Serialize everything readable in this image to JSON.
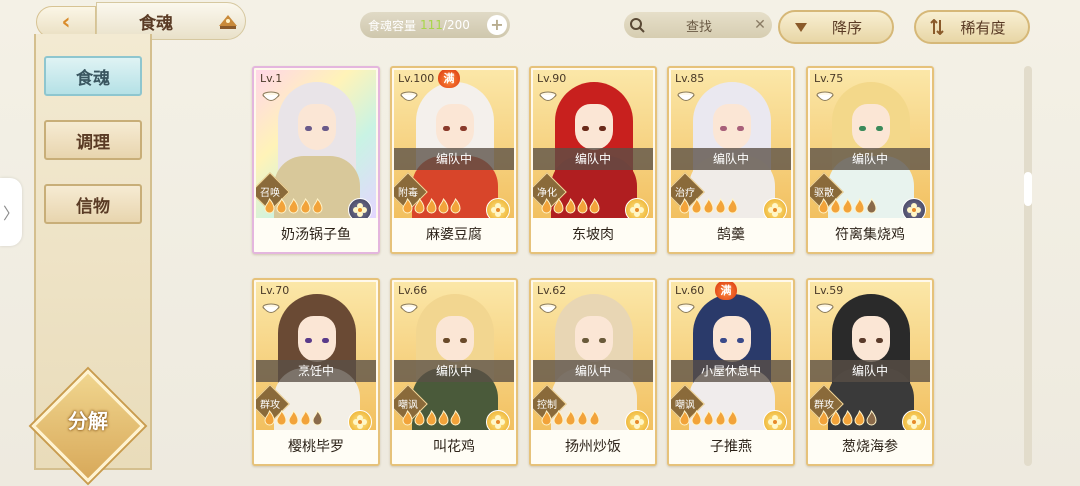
{
  "header": {
    "title": "食魂",
    "capacity_label": "食魂容量",
    "capacity_current": "111",
    "capacity_max": "/200",
    "capacity_add": "+",
    "search_label": "查找",
    "search_clear": "✕",
    "sort_order": "降序",
    "sort_rarity": "稀有度"
  },
  "sidebar": {
    "items": [
      {
        "label": "食魂",
        "active": true
      },
      {
        "label": "调理",
        "active": false
      },
      {
        "label": "信物",
        "active": false
      }
    ],
    "decompose": "分解",
    "edge_handle": "〉"
  },
  "cards": [
    {
      "level": "Lv.1",
      "name": "奶汤锅子鱼",
      "status": "",
      "role": "召唤",
      "full": false,
      "rarity": "sr",
      "element": "dark",
      "hair": "#e9e4e8",
      "clothes": "#d8c89a",
      "eyes": "#6a5a8a",
      "flames_lit": 5
    },
    {
      "level": "Lv.100",
      "name": "麻婆豆腐",
      "status": "编队中",
      "role": "附毒",
      "full": true,
      "full_label": "满",
      "rarity": "normal",
      "element": "gold",
      "hair": "#f4f0ec",
      "clothes": "#d8452a",
      "eyes": "#8a3a2a",
      "flames_lit": 5
    },
    {
      "level": "Lv.90",
      "name": "东坡肉",
      "status": "编队中",
      "role": "净化",
      "full": false,
      "rarity": "normal",
      "element": "gold",
      "hair": "#c8201e",
      "clothes": "#b01e20",
      "eyes": "#6a2a1a",
      "flames_lit": 5
    },
    {
      "level": "Lv.85",
      "name": "鹄羹",
      "status": "编队中",
      "role": "治疗",
      "full": false,
      "rarity": "normal",
      "element": "gold",
      "hair": "#eae8f0",
      "clothes": "#f0ece8",
      "eyes": "#a8607a",
      "flames_lit": 5
    },
    {
      "level": "Lv.75",
      "name": "符离集烧鸡",
      "status": "编队中",
      "role": "驱散",
      "full": false,
      "rarity": "normal",
      "element": "dark",
      "hair": "#f3d88a",
      "clothes": "#e8f3ee",
      "eyes": "#3a8a5a",
      "flames_lit": 4
    },
    {
      "level": "Lv.70",
      "name": "樱桃毕罗",
      "status": "烹饪中",
      "role": "群攻",
      "full": false,
      "rarity": "normal",
      "element": "gold",
      "hair": "#6a4a34",
      "clothes": "#f3efe6",
      "eyes": "#5a3a8a",
      "flames_lit": 4
    },
    {
      "level": "Lv.66",
      "name": "叫花鸡",
      "status": "编队中",
      "role": "嘲讽",
      "full": false,
      "rarity": "normal",
      "element": "gold",
      "hair": "#f2d690",
      "clothes": "#4a5a3a",
      "eyes": "#6a4a2a",
      "flames_lit": 5
    },
    {
      "level": "Lv.62",
      "name": "扬州炒饭",
      "status": "编队中",
      "role": "控制",
      "full": false,
      "rarity": "normal",
      "element": "gold",
      "hair": "#e8d6b4",
      "clothes": "#f3ebdc",
      "eyes": "#6a5a3a",
      "flames_lit": 5
    },
    {
      "level": "Lv.60",
      "name": "子推燕",
      "status": "小屋休息中",
      "role": "嘲讽",
      "full": true,
      "full_label": "满",
      "rarity": "normal",
      "element": "gold",
      "hair": "#2a3a6a",
      "clothes": "#f0ecec",
      "eyes": "#3a4a8a",
      "flames_lit": 5
    },
    {
      "level": "Lv.59",
      "name": "葱烧海参",
      "status": "编队中",
      "role": "群攻",
      "full": false,
      "rarity": "normal",
      "element": "gold",
      "hair": "#2a2a2a",
      "clothes": "#3a3a3a",
      "eyes": "#5a3a2a",
      "flames_lit": 4
    }
  ],
  "colors": {
    "accent": "#e6c27a",
    "active_tab": "#b5e1e6",
    "status_bar": "#5a5046"
  }
}
